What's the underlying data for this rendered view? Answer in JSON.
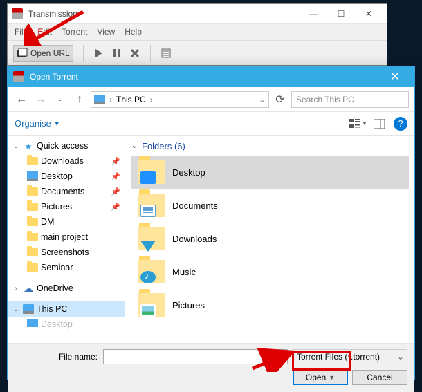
{
  "transmission": {
    "title": "Transmission",
    "menu": {
      "file": "File",
      "edit": "Edit",
      "torrent": "Torrent",
      "view": "View",
      "help": "Help"
    },
    "toolbar": {
      "open_url": "Open URL"
    }
  },
  "dialog": {
    "title": "Open Torrent",
    "breadcrumb": {
      "location": "This PC"
    },
    "search_placeholder": "Search This PC",
    "organise": "Organise",
    "folders_header": "Folders (6)",
    "tree": {
      "quick_access": "Quick access",
      "downloads": "Downloads",
      "desktop": "Desktop",
      "documents": "Documents",
      "pictures": "Pictures",
      "dm": "DM",
      "main_project": "main project",
      "screenshots": "Screenshots",
      "seminar": "Seminar",
      "onedrive": "OneDrive",
      "this_pc": "This PC",
      "desktop2": "Desktop"
    },
    "items": {
      "desktop": "Desktop",
      "documents": "Documents",
      "downloads": "Downloads",
      "music": "Music",
      "pictures": "Pictures"
    },
    "file_name_label": "File name:",
    "file_name_value": "",
    "filter": "Torrent Files (*.torrent)",
    "open_btn": "Open",
    "cancel_btn": "Cancel"
  }
}
